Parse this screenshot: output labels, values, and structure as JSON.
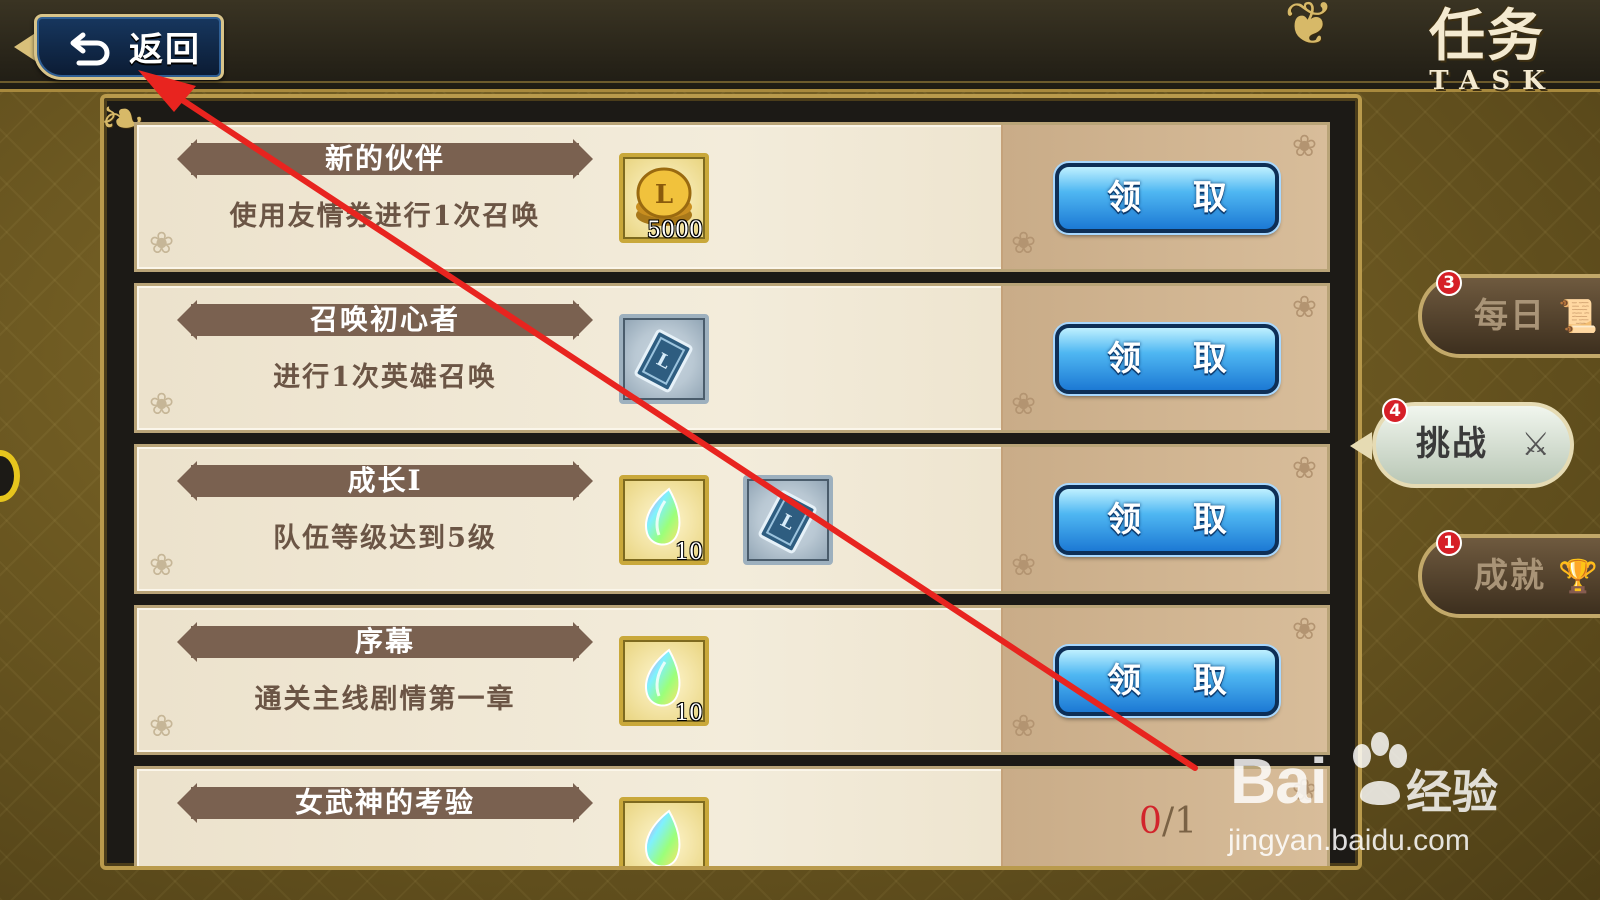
{
  "header": {
    "back_label": "返回",
    "title": "任务",
    "title_en": "TASK"
  },
  "tasks": [
    {
      "title": "新的伙伴",
      "description": "使用友情券进行1次召唤",
      "rewards": [
        {
          "icon": "gold-coin-icon",
          "frame": "gold",
          "qty": "5000"
        }
      ],
      "action_label": "领 取"
    },
    {
      "title": "召唤初心者",
      "description": "进行1次英雄召唤",
      "rewards": [
        {
          "icon": "summon-ticket-icon",
          "frame": "silver",
          "qty": ""
        }
      ],
      "action_label": "领 取"
    },
    {
      "title": "成长I",
      "description": "队伍等级达到5级",
      "rewards": [
        {
          "icon": "rainbow-crystal-icon",
          "frame": "gold",
          "qty": "10"
        },
        {
          "icon": "summon-ticket-icon",
          "frame": "silver",
          "qty": ""
        }
      ],
      "action_label": "领 取"
    },
    {
      "title": "序幕",
      "description": "通关主线剧情第一章",
      "rewards": [
        {
          "icon": "rainbow-crystal-icon",
          "frame": "gold",
          "qty": "10"
        }
      ],
      "action_label": "领 取"
    },
    {
      "title": "女武神的考验",
      "description": "",
      "rewards": [
        {
          "icon": "rainbow-crystal-icon",
          "frame": "gold",
          "qty": ""
        }
      ],
      "progress": {
        "current": "0",
        "separator": "/",
        "total": "1"
      }
    }
  ],
  "side_tabs": [
    {
      "label": "每日",
      "badge": "3",
      "icon": "scroll-icon",
      "active": false
    },
    {
      "label": "挑战",
      "badge": "4",
      "icon": "crossed-swords-icon",
      "active": true
    },
    {
      "label": "成就",
      "badge": "1",
      "icon": "trophy-icon",
      "active": false
    }
  ],
  "watermark": {
    "brand": "Bai",
    "brand_suffix": "经验",
    "url": "jingyan.baidu.com"
  },
  "colors": {
    "claim_button": "#2a8de0",
    "progress_current": "#d2242b",
    "badge": "#d61f27",
    "annotation_arrow": "#e8241f"
  }
}
